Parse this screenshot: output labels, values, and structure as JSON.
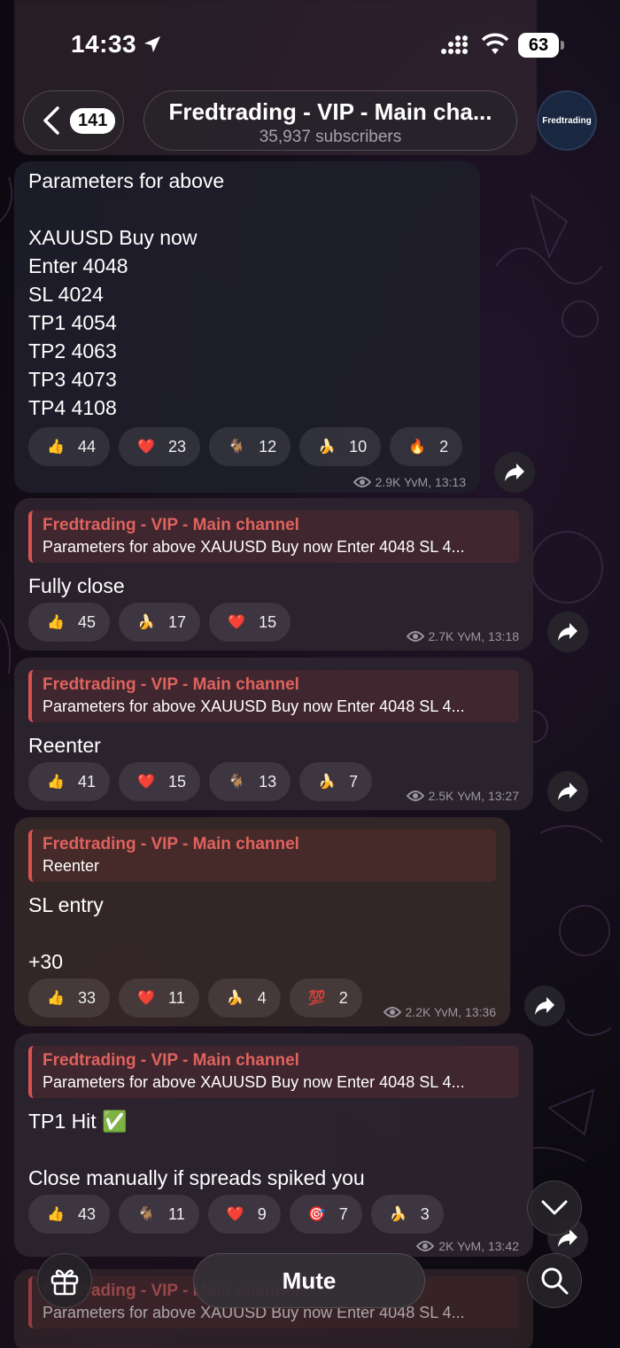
{
  "status_bar": {
    "time": "14:33",
    "battery": "63"
  },
  "header": {
    "back_count": "141",
    "title": "Fredtrading - VIP - Main cha...",
    "subtitle": "35,937 subscribers",
    "avatar_text": "Fredtrading"
  },
  "messages": [
    {
      "text": "Parameters  for above\n\nXAUUSD Buy now\nEnter 4048\nSL 4024\nTP1 4054\nTP2 4063\nTP3 4073\nTP4 4108",
      "reactions": [
        {
          "emoji": "thumbs-up",
          "count": "44"
        },
        {
          "emoji": "heart",
          "count": "23"
        },
        {
          "emoji": "goat",
          "count": "12"
        },
        {
          "emoji": "banana",
          "count": "10"
        },
        {
          "emoji": "fire",
          "count": "2"
        }
      ],
      "meta": "2.9K YvM, 13:13"
    },
    {
      "reply_title": "Fredtrading - VIP - Main channel",
      "reply_text": "Parameters for above XAUUSD Buy now Enter 4048 SL 4...",
      "text": "Fully close",
      "reactions": [
        {
          "emoji": "thumbs-up",
          "count": "45"
        },
        {
          "emoji": "banana",
          "count": "17"
        },
        {
          "emoji": "heart",
          "count": "15"
        }
      ],
      "meta": "2.7K YvM, 13:18"
    },
    {
      "reply_title": "Fredtrading - VIP - Main channel",
      "reply_text": "Parameters for above XAUUSD Buy now Enter 4048 SL 4...",
      "text": "Reenter",
      "reactions": [
        {
          "emoji": "thumbs-up",
          "count": "41"
        },
        {
          "emoji": "heart",
          "count": "15"
        },
        {
          "emoji": "goat",
          "count": "13"
        },
        {
          "emoji": "banana",
          "count": "7"
        }
      ],
      "meta": "2.5K YvM, 13:27"
    },
    {
      "reply_title": "Fredtrading - VIP - Main channel",
      "reply_text": "Reenter",
      "text": "SL entry\n\n+30",
      "reactions": [
        {
          "emoji": "thumbs-up",
          "count": "33"
        },
        {
          "emoji": "heart",
          "count": "11"
        },
        {
          "emoji": "banana",
          "count": "4"
        },
        {
          "emoji": "hundred",
          "count": "2"
        }
      ],
      "meta": "2.2K YvM, 13:36"
    },
    {
      "reply_title": "Fredtrading - VIP - Main channel",
      "reply_text": "Parameters for above XAUUSD Buy now Enter 4048 SL 4...",
      "text": "TP1 Hit ✅\n\nClose manually if spreads spiked you",
      "reactions": [
        {
          "emoji": "thumbs-up",
          "count": "43"
        },
        {
          "emoji": "goat",
          "count": "11"
        },
        {
          "emoji": "heart",
          "count": "9"
        },
        {
          "emoji": "target",
          "count": "7"
        },
        {
          "emoji": "banana",
          "count": "3"
        }
      ],
      "meta": "2K YvM, 13:42"
    }
  ],
  "partial_message": {
    "reply_title": "Fredtrading - VIP - Main channel",
    "reply_text": "Parameters for above XAUUSD Buy now Enter 4048 SL 4..."
  },
  "bottom_bar": {
    "mute_label": "Mute"
  },
  "colors": {
    "reply_accent": "#e0625d",
    "background": "#0c0a10"
  }
}
